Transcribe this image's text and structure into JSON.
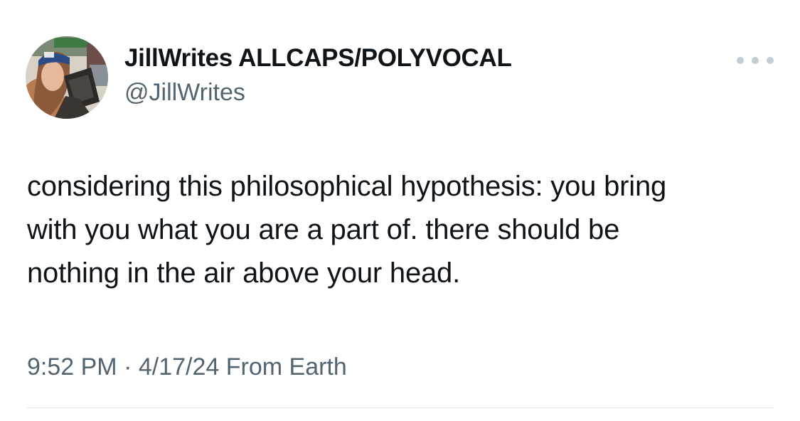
{
  "author": {
    "display_name": "JillWrites ALLCAPS/POLYVOCAL",
    "handle": "@JillWrites"
  },
  "tweet": {
    "text_lines": [
      "considering this philosophical hypothesis: you bring",
      "with you what you are a part of. there should be",
      "nothing in the air above your head."
    ]
  },
  "meta": {
    "time": "9:52 PM",
    "separator": " · ",
    "date": "4/17/24",
    "source": " From Earth"
  },
  "icons": {
    "more": "more-horizontal-icon"
  },
  "colors": {
    "text_primary": "#0f1419",
    "text_secondary": "#536471",
    "divider": "#e1e6ea"
  }
}
